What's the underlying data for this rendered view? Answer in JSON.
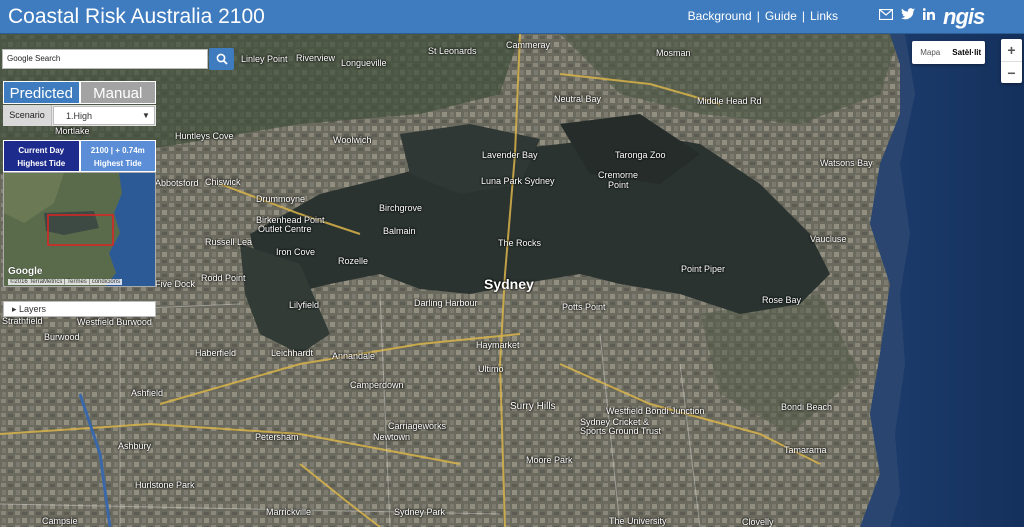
{
  "header": {
    "title": "Coastal Risk Australia 2100",
    "links": [
      "Background",
      "Guide",
      "Links"
    ],
    "separator": "|",
    "social_icons": [
      "mail-icon",
      "twitter-icon",
      "linkedin-icon"
    ],
    "brand": "ngis"
  },
  "search": {
    "placeholder": "Google Search"
  },
  "mode_tabs": {
    "predicted": "Predicted",
    "manual": "Manual",
    "active": "Predicted"
  },
  "scenario": {
    "label": "Scenario",
    "value": "1.High"
  },
  "tide": {
    "current_line1": "Current Day",
    "current_line2": "Highest Tide",
    "future_line1": "2100 | + 0.74m",
    "future_line2": "Highest Tide"
  },
  "minimap": {
    "attribution": "©2016 TerraMetrics",
    "terms": "Termes",
    "conditions": "condicions",
    "google": "Google"
  },
  "layers": {
    "label": "Layers"
  },
  "map_type": {
    "map": "Mapa",
    "satellite": "Satèl·lit"
  },
  "zoom": {
    "in": "+",
    "out": "−"
  },
  "places": [
    {
      "name": "Cammeray"
    },
    {
      "name": "St Leonards"
    },
    {
      "name": "Linley Point"
    },
    {
      "name": "Riverview"
    },
    {
      "name": "Longueville"
    },
    {
      "name": "Mosman"
    },
    {
      "name": "Neutral Bay"
    },
    {
      "name": "Middle Head Rd"
    },
    {
      "name": "Huntleys Cove"
    },
    {
      "name": "Woolwich"
    },
    {
      "name": "Lavender Bay"
    },
    {
      "name": "Taronga Zoo"
    },
    {
      "name": "Watsons Bay"
    },
    {
      "name": "Chiswick"
    },
    {
      "name": "Drummoyne"
    },
    {
      "name": "Luna Park Sydney"
    },
    {
      "name": "Cremorne"
    },
    {
      "name": "Point"
    },
    {
      "name": "Birchgrove"
    },
    {
      "name": "Balmain"
    },
    {
      "name": "Birkenhead Point"
    },
    {
      "name": "Outlet Centre"
    },
    {
      "name": "Russell Lea"
    },
    {
      "name": "Iron Cove"
    },
    {
      "name": "The Rocks"
    },
    {
      "name": "Vaucluse"
    },
    {
      "name": "Rozelle"
    },
    {
      "name": "Point Piper"
    },
    {
      "name": "Rodd Point"
    },
    {
      "name": "Five Dock"
    },
    {
      "name": "Sydney"
    },
    {
      "name": "Darling Harbour"
    },
    {
      "name": "Potts Point"
    },
    {
      "name": "Rose Bay"
    },
    {
      "name": "Lilyfield"
    },
    {
      "name": "Westfield Burwood"
    },
    {
      "name": "Burwood"
    },
    {
      "name": "Haymarket"
    },
    {
      "name": "Haberfield"
    },
    {
      "name": "Leichhardt"
    },
    {
      "name": "Annandale"
    },
    {
      "name": "Ultimo"
    },
    {
      "name": "Camperdown"
    },
    {
      "name": "Ashfield"
    },
    {
      "name": "Surry Hills"
    },
    {
      "name": "Westfield Bondi Junction"
    },
    {
      "name": "Bondi Beach"
    },
    {
      "name": "Carriageworks"
    },
    {
      "name": "Sydney Cricket &"
    },
    {
      "name": "Sports Ground Trust"
    },
    {
      "name": "Newtown"
    },
    {
      "name": "Petersham"
    },
    {
      "name": "Ashbury"
    },
    {
      "name": "Moore Park"
    },
    {
      "name": "Tamarama"
    },
    {
      "name": "Hurlstone Park"
    },
    {
      "name": "Marrickville"
    },
    {
      "name": "Sydney Park"
    },
    {
      "name": "The University"
    },
    {
      "name": "Clovelly"
    },
    {
      "name": "Campsie"
    },
    {
      "name": "Strathfield"
    },
    {
      "name": "Mortlake"
    },
    {
      "name": "Abbotsford"
    }
  ]
}
